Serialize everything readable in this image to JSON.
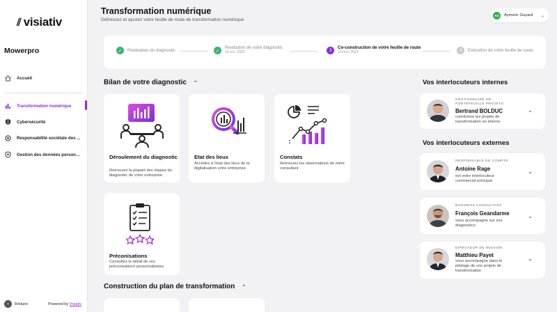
{
  "sidebar": {
    "logo_text": "visiativ",
    "org_name": "Mowerpro",
    "items": [
      {
        "label": "Accueil",
        "icon": "home-icon"
      },
      {
        "label": "Transformation numérique",
        "icon": "bar-chart-icon",
        "active": true
      },
      {
        "label": "Cybersécurité",
        "icon": "shield-icon"
      },
      {
        "label": "Responsabilité sociétale des ...",
        "icon": "globe-icon"
      },
      {
        "label": "Gestion des données personn...",
        "icon": "data-shield-icon"
      }
    ],
    "collapse_label": "Réduire",
    "powered_by": "Powered by",
    "powered_link": "Visiativ"
  },
  "header": {
    "title": "Transformation numérique",
    "subtitle": "Définissez et ajustez votre feuille de route de transformation numérique"
  },
  "user": {
    "initials": "AG",
    "name": "Aymeric Guyard"
  },
  "stepper": {
    "steps": [
      {
        "number": "1",
        "label": "Réalisation du diagnostic",
        "date": "",
        "status": "done"
      },
      {
        "number": "2",
        "label": "Restitution de votre diagnostic",
        "date": "15 oct. 2023",
        "status": "done"
      },
      {
        "number": "3",
        "label": "Co-construction de votre feuille de route",
        "date": "13 nov. 2023",
        "status": "current"
      },
      {
        "number": "4",
        "label": "Exécution de votre feuille de route",
        "date": "",
        "status": "todo"
      }
    ]
  },
  "bilan": {
    "title": "Bilan de votre diagnostic",
    "cards": [
      {
        "title": "Déroulement du diagnostic",
        "desc": "Retrouvez la plupart des étapes du diagnostic de votre entreprise",
        "icon": "meeting-icon"
      },
      {
        "title": "Etat des lieux",
        "desc": "Accédez à l'état des lieux de la digitalisation votre entreprise",
        "icon": "magnifier-chart-icon"
      },
      {
        "title": "Constats",
        "desc": "Retrouvez les observations de notre consultant",
        "icon": "growth-chart-icon"
      },
      {
        "title": "Préconisations",
        "desc": "Consultez le détail de vos préconisations personnalisées",
        "icon": "checklist-stars-icon"
      }
    ]
  },
  "construction": {
    "title": "Construction du plan de transformation"
  },
  "internes": {
    "title": "Vos interlocuteurs internes",
    "contacts": [
      {
        "role": "GESTIONNAIRE DE PORTEFEUILLE PROJETS",
        "name": "Bertrand BOLDUC",
        "desc": "coordonne les projets de transformation en interne"
      }
    ]
  },
  "externes": {
    "title": "Vos interlocuteurs externes",
    "contacts": [
      {
        "role": "RESPONSABLE DE COMPTE",
        "name": "Antoine Rage",
        "desc": "est votre interlocuteur commercial principal"
      },
      {
        "role": "BUSINESS CONSULTANT",
        "name": "François Geandarme",
        "desc": "vous accompagne sur vos diagnostics"
      },
      {
        "role": "DIRECTEUR DE MISSION",
        "name": "Matthieu Payet",
        "desc": "vous accompagne dans le pilotage de vos projets de transformation"
      }
    ]
  },
  "colors": {
    "accent": "#8a2be2",
    "done": "#3cb46e",
    "background": "#f2f2f4"
  }
}
